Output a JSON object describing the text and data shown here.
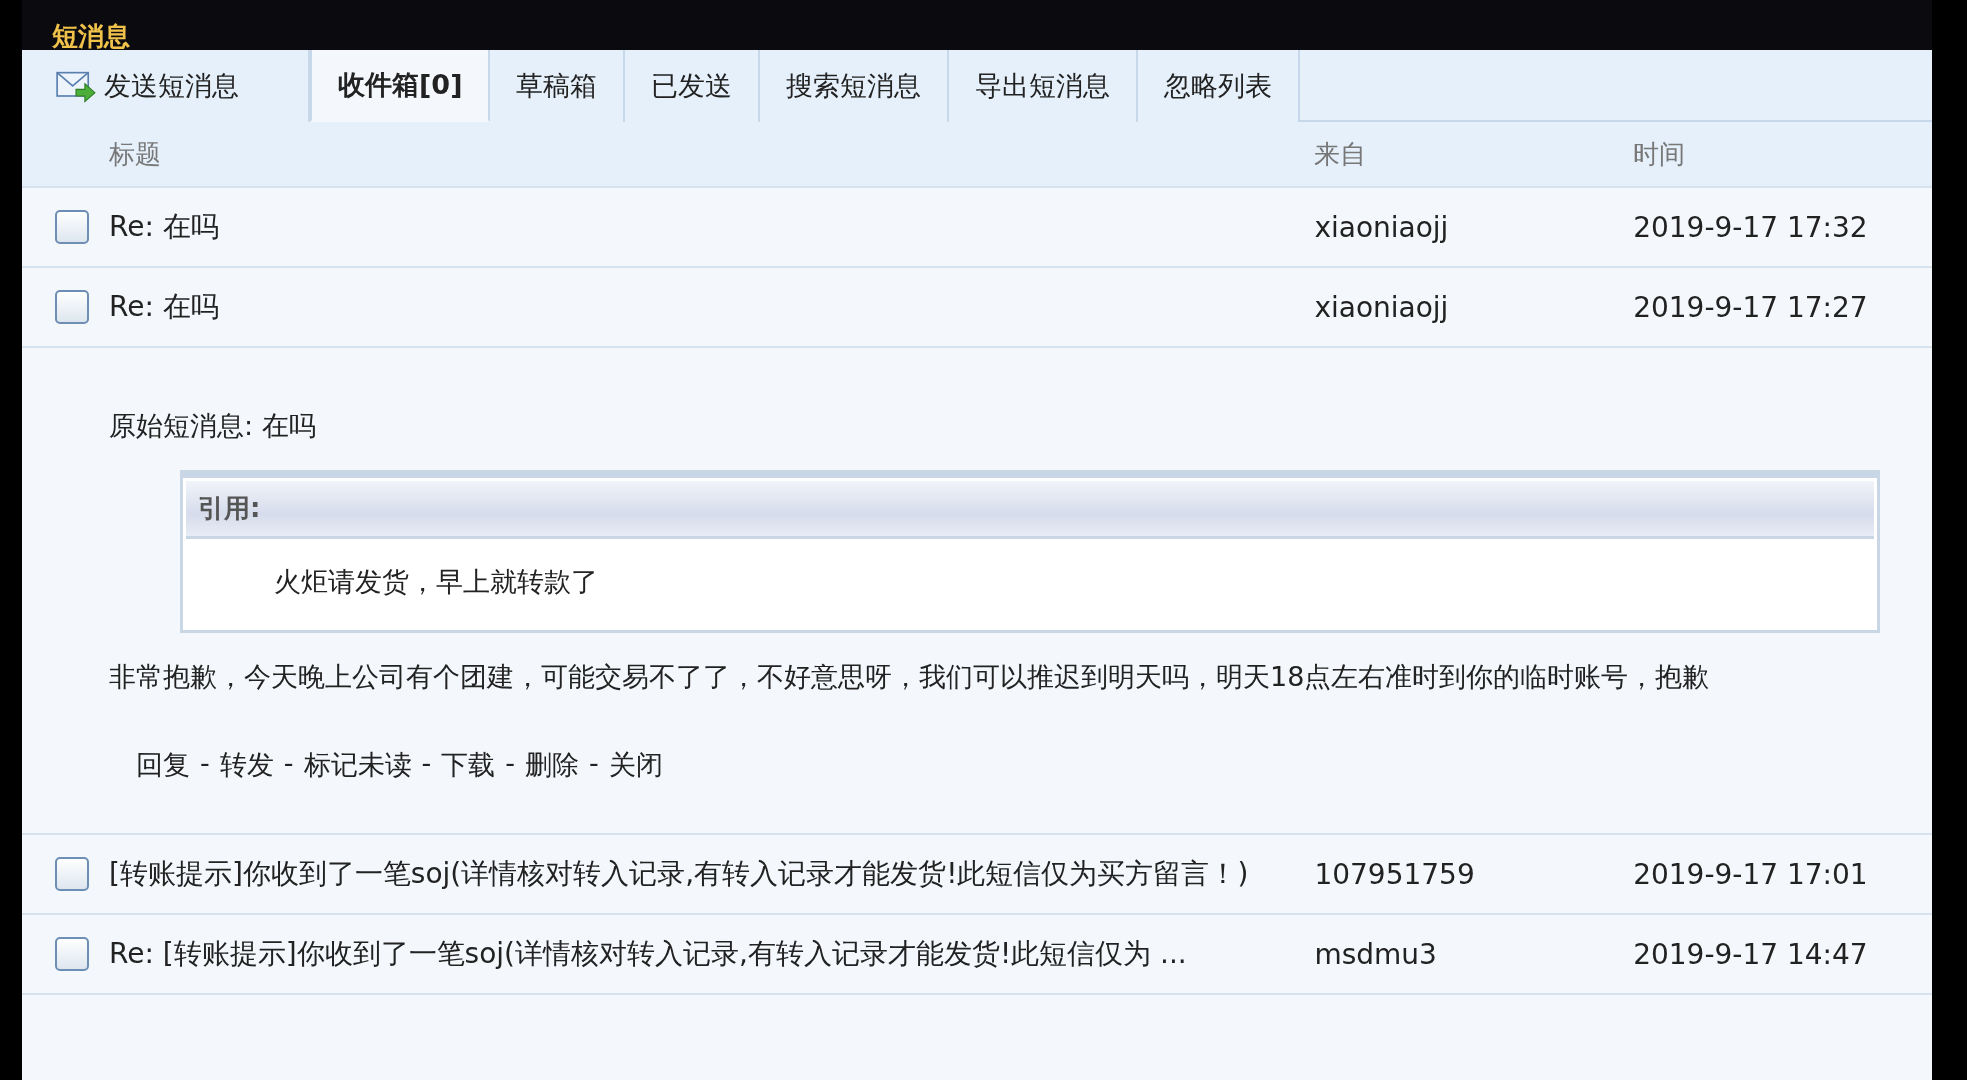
{
  "header": {
    "title": "短消息"
  },
  "tabs": [
    {
      "label": "发送短消息",
      "selected": false,
      "kind": "compose"
    },
    {
      "label": "收件箱[0]",
      "selected": true,
      "kind": "plain"
    },
    {
      "label": "草稿箱",
      "selected": false,
      "kind": "plain"
    },
    {
      "label": "已发送",
      "selected": false,
      "kind": "plain"
    },
    {
      "label": "搜索短消息",
      "selected": false,
      "kind": "plain"
    },
    {
      "label": "导出短消息",
      "selected": false,
      "kind": "plain"
    },
    {
      "label": "忽略列表",
      "selected": false,
      "kind": "plain"
    }
  ],
  "table": {
    "columns": [
      "标题",
      "来自",
      "时间"
    ],
    "rows": [
      {
        "title": "Re: 在吗",
        "from": "xiaoniaojj",
        "time": "2019-9-17 17:32",
        "checked": false
      },
      {
        "title": "Re: 在吗",
        "from": "xiaoniaojj",
        "time": "2019-9-17 17:27",
        "checked": false,
        "detail": {
          "original": "原始短消息: 在吗",
          "quote_label": "引用:",
          "quote": "火炬请发货，早上就转款了",
          "body": "非常抱歉，今天晚上公司有个团建，可能交易不了了，不好意思呀，我们可以推迟到明天吗，明天18点左右准时到你的临时账号，抱歉",
          "actions": [
            "回复",
            "转发",
            "标记未读",
            "下载",
            "删除",
            "关闭"
          ],
          "separator": "-"
        }
      },
      {
        "title": "[转账提示]你收到了一笔soj(详情核对转入记录,有转入记录才能发货!此短信仅为买方留言！)",
        "from": "107951759",
        "time": "2019-9-17 17:01",
        "checked": false
      },
      {
        "title": "Re: [转账提示]你收到了一笔soj(详情核对转入记录,有转入记录才能发货!此短信仅为 ...",
        "from": "msdmu3",
        "time": "2019-9-17 14:47",
        "checked": false
      }
    ]
  }
}
